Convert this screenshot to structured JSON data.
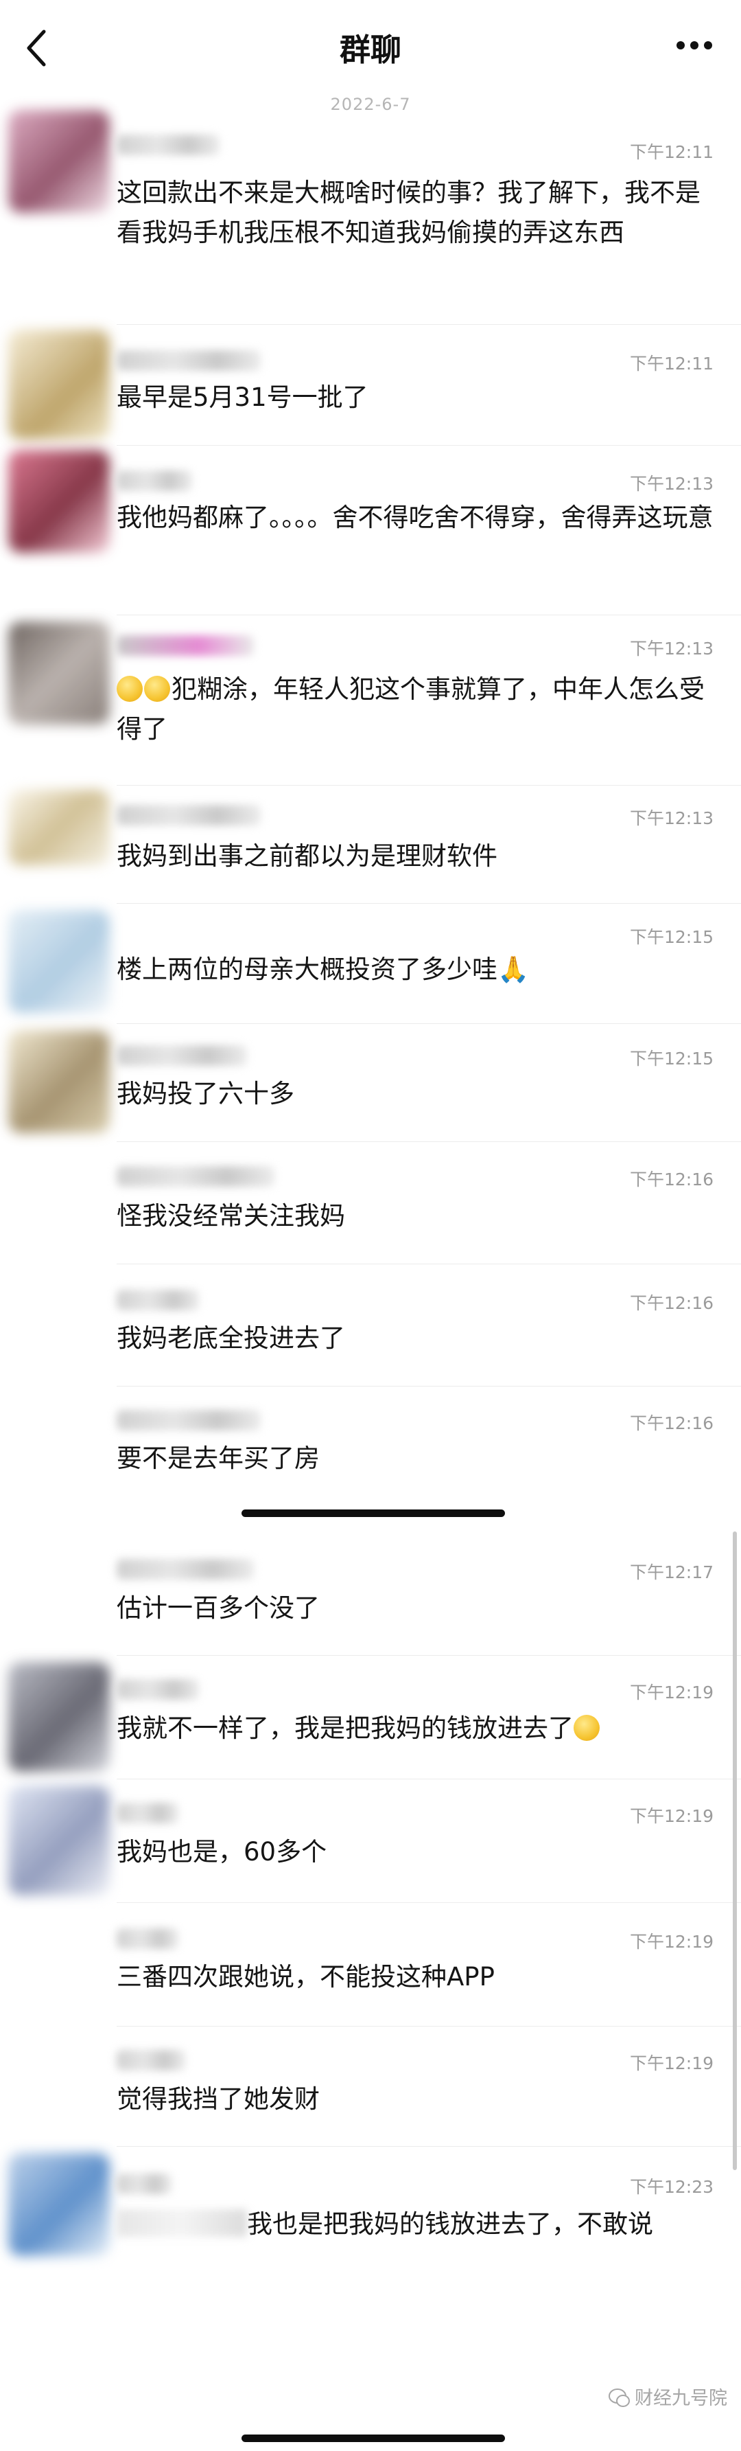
{
  "nav": {
    "title": "群聊"
  },
  "date_label": "2022-6-7",
  "messages": [
    {
      "time": "下午12:11",
      "text": "这回款出不来是大概啥时候的事？我了解下，我不是看我妈手机我压根不知道我妈偷摸的弄这东西",
      "avatar_colors": [
        "#c98aa6",
        "#8c4761"
      ]
    },
    {
      "time": "下午12:11",
      "text": "最早是5月31号一批了",
      "avatar_colors": [
        "#e8d8a2",
        "#b89c5c"
      ]
    },
    {
      "time": "下午12:13",
      "text": "我他妈都麻了。。。。舍不得吃舍不得穿，舍得弄这玩意",
      "avatar_colors": [
        "#b0445e",
        "#7a2336"
      ]
    },
    {
      "time": "下午12:13",
      "text": "犯糊涂，年轻人犯这个事就算了，中年人怎么受得了",
      "avatar_colors": [
        "#7a6f6a",
        "#b3aaa5"
      ]
    },
    {
      "time": "下午12:13",
      "text": "我妈到出事之前都以为是理财软件",
      "avatar_colors": [
        "#f1ead9",
        "#cdbb8c"
      ]
    },
    {
      "time": "下午12:15",
      "text": "楼上两位的母亲大概投资了多少哇",
      "avatar_colors": [
        "#a9c8e0",
        "#e2edf5"
      ]
    },
    {
      "time": "下午12:15",
      "text": "我妈投了六十多",
      "avatar_colors": [
        "#d6c9a6",
        "#9e8a63"
      ]
    },
    {
      "time": "下午12:16",
      "text": "怪我没经常关注我妈"
    },
    {
      "time": "下午12:16",
      "text": "我妈老底全投进去了"
    },
    {
      "time": "下午12:16",
      "text": "要不是去年买了房"
    },
    {
      "time": "下午12:17",
      "text": "估计一百多个没了"
    },
    {
      "time": "下午12:19",
      "text": "我就不一样了，我是把我妈的钱放进去了",
      "avatar_colors": [
        "#6a6a74",
        "#b4b6c0"
      ]
    },
    {
      "time": "下午12:19",
      "text": "我妈也是，60多个",
      "avatar_colors": [
        "#c8d0e6",
        "#8a95b8"
      ]
    },
    {
      "time": "下午12:19",
      "text": "三番四次跟她说，不能投这种APP"
    },
    {
      "time": "下午12:19",
      "text": "觉得我挡了她发财"
    },
    {
      "time": "下午12:23",
      "text": "我也是把我妈的钱放进去了，不敢说",
      "avatar_colors": [
        "#4f86c6",
        "#b7cde8"
      ]
    }
  ],
  "watermark": "财经九号院"
}
